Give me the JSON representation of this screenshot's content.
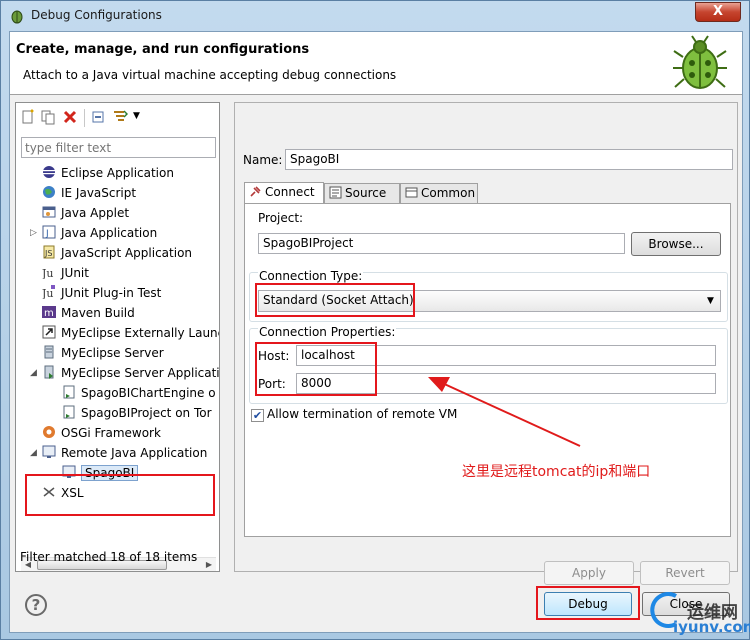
{
  "window": {
    "title": "Debug Configurations",
    "close_glyph": "X"
  },
  "banner": {
    "title": "Create, manage, and run configurations",
    "description": "Attach to a Java virtual machine accepting debug connections"
  },
  "left": {
    "filter_placeholder": "type filter text",
    "tree": [
      {
        "label": "Eclipse Application",
        "icon": "eclipse-icon"
      },
      {
        "label": "IE JavaScript",
        "icon": "globe-icon"
      },
      {
        "label": "Java Applet",
        "icon": "applet-icon"
      },
      {
        "label": "Java Application",
        "icon": "java-app-icon"
      },
      {
        "label": "JavaScript Application",
        "icon": "js-app-icon"
      },
      {
        "label": "JUnit",
        "icon": "junit-icon"
      },
      {
        "label": "JUnit Plug-in Test",
        "icon": "junit-plugin-icon"
      },
      {
        "label": "Maven Build",
        "icon": "maven-icon"
      },
      {
        "label": "MyEclipse Externally Launc",
        "icon": "external-launch-icon"
      },
      {
        "label": "MyEclipse Server",
        "icon": "server-icon"
      },
      {
        "label": "MyEclipse Server Applicati",
        "icon": "server-app-icon"
      },
      {
        "label": "SpagoBIChartEngine o",
        "icon": "config-icon"
      },
      {
        "label": "SpagoBIProject on Tor",
        "icon": "config-icon"
      },
      {
        "label": "OSGi Framework",
        "icon": "osgi-icon"
      },
      {
        "label": "Remote Java Application",
        "icon": "remote-java-icon"
      },
      {
        "label": "SpagoBI",
        "icon": "remote-config-icon"
      },
      {
        "label": "XSL",
        "icon": "xsl-icon"
      }
    ],
    "filter_status": "Filter matched 18 of 18 items"
  },
  "right": {
    "name_label": "Name:",
    "name_value": "SpagoBI",
    "tabs": [
      {
        "label": "Connect"
      },
      {
        "label": "Source"
      },
      {
        "label": "Common"
      }
    ],
    "project_label": "Project:",
    "project_value": "SpagoBIProject",
    "browse_label": "Browse...",
    "connection_type_label": "Connection Type:",
    "connection_type_value": "Standard (Socket Attach)",
    "connection_props_label": "Connection Properties:",
    "host_label": "Host:",
    "host_value": "localhost",
    "port_label": "Port:",
    "port_value": "8000",
    "allow_termination_label": "Allow termination of remote VM",
    "allow_termination_checked": true,
    "apply_label": "Apply",
    "revert_label": "Revert"
  },
  "annotation": {
    "text": "这里是远程tomcat的ip和端口"
  },
  "bottom": {
    "help_glyph": "?",
    "debug_label": "Debug",
    "close_label": "Close"
  },
  "watermark": {
    "cn": "运维网",
    "url": "iyunv.com"
  },
  "colors": {
    "highlight_red": "#e4161c",
    "selection_blue": "#dbe9f7"
  }
}
